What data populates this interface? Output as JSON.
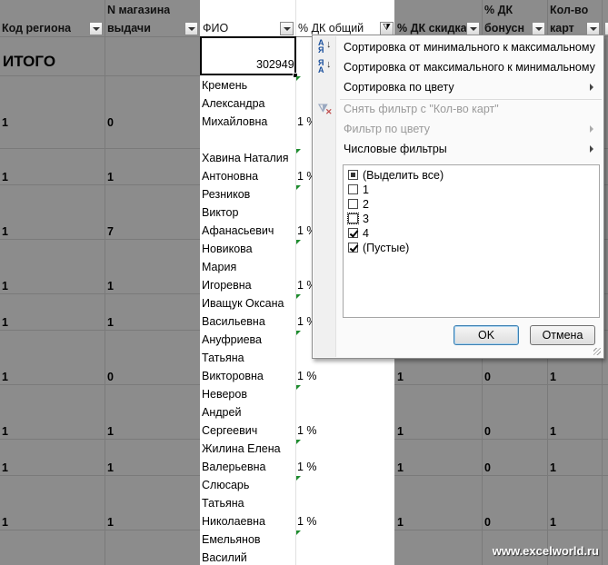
{
  "headers": {
    "region": "Код региона",
    "store_line1": "N магазина",
    "store_line2": "выдачи",
    "fio": "ФИО",
    "dk_total": "% ДК общий",
    "dk_discount": "% ДК скидка",
    "dk_bonus_line1": "% ДК",
    "dk_bonus_line2": "бонусн",
    "cards_line1": "Кол-во",
    "cards_line2": "карт"
  },
  "totals": {
    "label": "ИТОГО",
    "value": "302949"
  },
  "rows": [
    {
      "region": "1",
      "store": "0",
      "fio": [
        "Кремень",
        "Александра",
        "Михайловна"
      ],
      "dk_total": "1 %"
    },
    {
      "region": "1",
      "store": "1",
      "fio": [
        "Хавина Наталия",
        "Антоновна"
      ],
      "dk_total": "1 %"
    },
    {
      "region": "1",
      "store": "7",
      "fio": [
        "Резников",
        "Виктор",
        "Афанасьевич"
      ],
      "dk_total": "1 %"
    },
    {
      "region": "1",
      "store": "1",
      "fio": [
        "Новикова",
        "Мария",
        "Игоревна"
      ],
      "dk_total": "1 %"
    },
    {
      "region": "1",
      "store": "1",
      "fio": [
        "Иващук Оксана",
        "Васильевна"
      ],
      "dk_total": "1 %"
    },
    {
      "region": "1",
      "store": "0",
      "fio": [
        "Ануфриева",
        "Татьяна",
        "Викторовна"
      ],
      "dk_total": "1 %",
      "dk_discount": "1",
      "dk_bonus": "0",
      "cards": "1"
    },
    {
      "region": "1",
      "store": "1",
      "fio": [
        "Неверов",
        "Андрей",
        "Сергеевич"
      ],
      "dk_total": "1 %",
      "dk_discount": "1",
      "dk_bonus": "0",
      "cards": "1"
    },
    {
      "region": "1",
      "store": "1",
      "fio": [
        "Жилина Елена",
        "Валерьевна"
      ],
      "dk_total": "1 %",
      "dk_discount": "1",
      "dk_bonus": "0",
      "cards": "1"
    },
    {
      "region": "1",
      "store": "1",
      "fio": [
        "Слюсарь",
        "Татьяна",
        "Николаевна"
      ],
      "dk_total": "1 %",
      "dk_discount": "1",
      "dk_bonus": "0",
      "cards": "1"
    },
    {
      "fio": [
        "Емельянов",
        "Василий"
      ]
    }
  ],
  "filter_menu": {
    "sort_asc": "Сортировка от минимального к максимальному",
    "sort_desc": "Сортировка от максимального к минимальному",
    "sort_by_color": "Сортировка по цвету",
    "clear_filter": "Снять фильтр с \"Кол-во карт\"",
    "filter_by_color": "Фильтр по цвету",
    "number_filters": "Числовые фильтры",
    "values": [
      {
        "label": "(Выделить все)",
        "state": "mixed"
      },
      {
        "label": "1",
        "state": "unchecked"
      },
      {
        "label": "2",
        "state": "unchecked"
      },
      {
        "label": "3",
        "state": "unchecked"
      },
      {
        "label": "4",
        "state": "checked"
      },
      {
        "label": "(Пустые)",
        "state": "checked"
      }
    ],
    "ok": "OK",
    "cancel": "Отмена"
  },
  "watermark": "www.excelworld.ru",
  "colors": {
    "grid_bg": "#8c8c8c",
    "white_col": "#ffffff",
    "check_accent": "#1e8c2e"
  }
}
